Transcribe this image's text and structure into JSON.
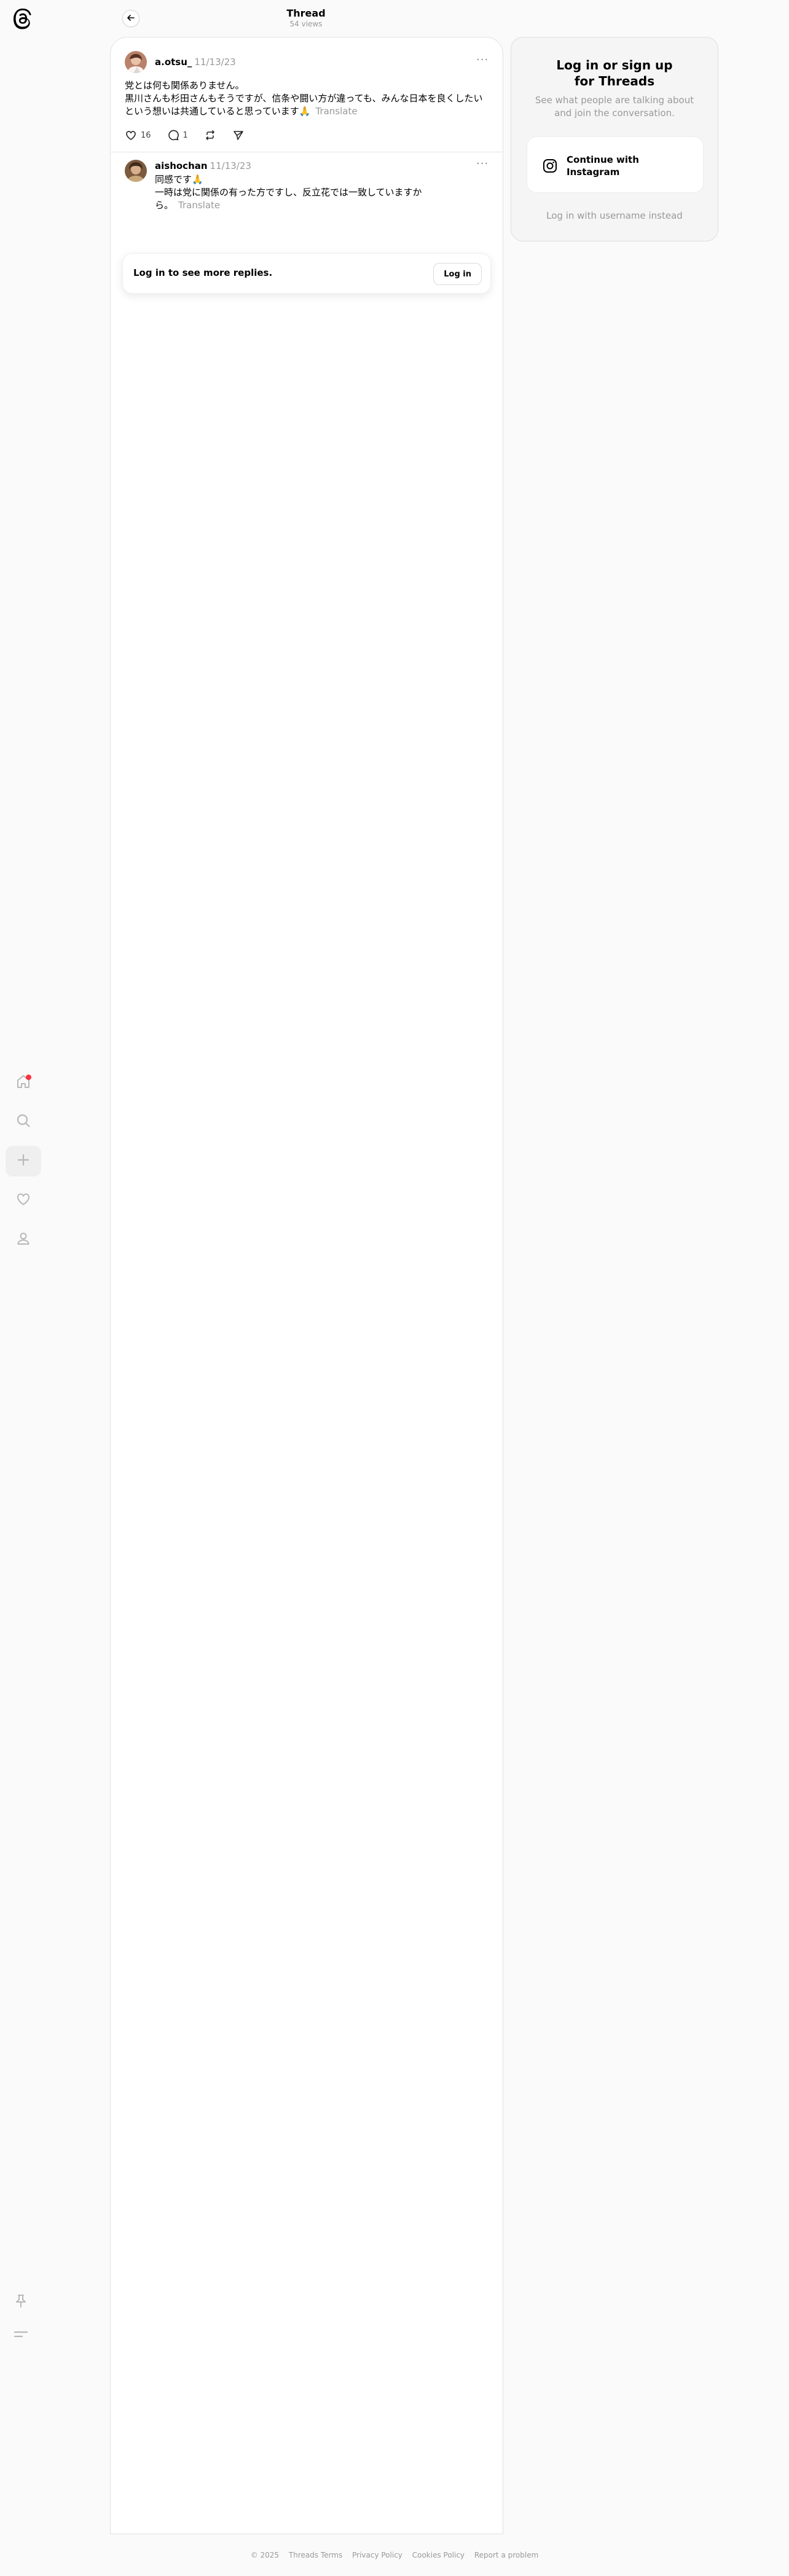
{
  "header": {
    "title": "Thread",
    "subtitle": "54 views"
  },
  "nav": {
    "items": [
      {
        "name": "home",
        "icon": "home-icon",
        "has_notification": true
      },
      {
        "name": "search",
        "icon": "search-icon"
      },
      {
        "name": "create",
        "icon": "plus-icon",
        "active": true
      },
      {
        "name": "activity",
        "icon": "heart-icon"
      },
      {
        "name": "profile",
        "icon": "person-icon"
      }
    ],
    "bottom": [
      {
        "name": "pin",
        "icon": "pin-icon"
      },
      {
        "name": "menu",
        "icon": "menu-icon"
      }
    ]
  },
  "posts": [
    {
      "username": "a.otsu_",
      "time": "11/13/23",
      "lines": [
        "党とは何も関係ありません。",
        "黒川さんも杉田さんもそうですが、信条や闘い方が違っても、みんな日本を良くしたい",
        "という想いは共通していると思っています🙏"
      ],
      "translate": "Translate",
      "likes": "16",
      "replies": "1"
    },
    {
      "username": "aishochan",
      "time": "11/13/23",
      "lines": [
        "同感です🙏",
        "一時は党に関係の有った方ですし、反立花では一致していますか",
        "ら。"
      ],
      "translate": "Translate"
    }
  ],
  "more_label": "···",
  "login_bar": {
    "text": "Log in to see more replies.",
    "button": "Log in"
  },
  "panel": {
    "title": "Log in or sign up for Threads",
    "subtitle": "See what people are talking about and join the conversation.",
    "instagram_button": "Continue with Instagram",
    "alt_login": "Log in with username instead"
  },
  "footer": {
    "copyright": "© 2025",
    "links": [
      "Threads Terms",
      "Privacy Policy",
      "Cookies Policy",
      "Report a problem"
    ]
  },
  "colors": {
    "notification": "#ff3040",
    "muted": "#999999"
  }
}
